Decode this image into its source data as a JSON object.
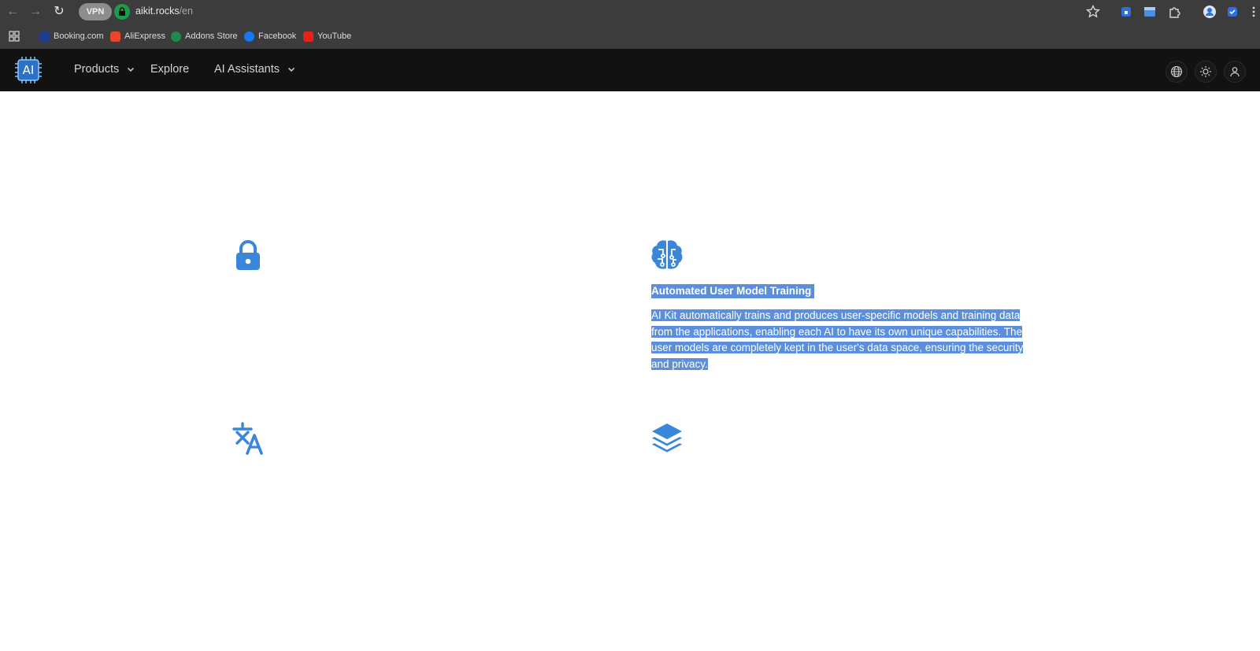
{
  "browser": {
    "vpn_label": "VPN",
    "url_host": "aikit.rocks",
    "url_path": "/en",
    "bookmarks": [
      {
        "label": "Booking.com",
        "color": "#1f3d8f"
      },
      {
        "label": "AliExpress",
        "color": "#e8452c"
      },
      {
        "label": "Addons Store",
        "color": "#1e8a4c"
      },
      {
        "label": "Facebook",
        "color": "#1877f2"
      },
      {
        "label": "YouTube",
        "color": "#e62117"
      }
    ]
  },
  "site": {
    "logo_text": "AI",
    "menu": [
      {
        "label": "Products",
        "has_dropdown": true
      },
      {
        "label": "Explore",
        "has_dropdown": false
      },
      {
        "label": "AI Assistants",
        "has_dropdown": true
      }
    ],
    "header_icons": [
      "globe-icon",
      "sun-icon",
      "user-icon"
    ]
  },
  "features": {
    "accent_color": "#3a86d9",
    "selection_color": "#5b8fdc",
    "icons": [
      "lock-icon",
      "brain-icon",
      "translate-icon",
      "layers-icon"
    ],
    "highlighted": {
      "title": "Automated User Model Training",
      "description": "AI Kit automatically trains and produces user-specific models and training data from the applications, enabling each AI to have its own unique capabilities. The user models are completely kept in the user's data space, ensuring the security and privacy."
    }
  }
}
